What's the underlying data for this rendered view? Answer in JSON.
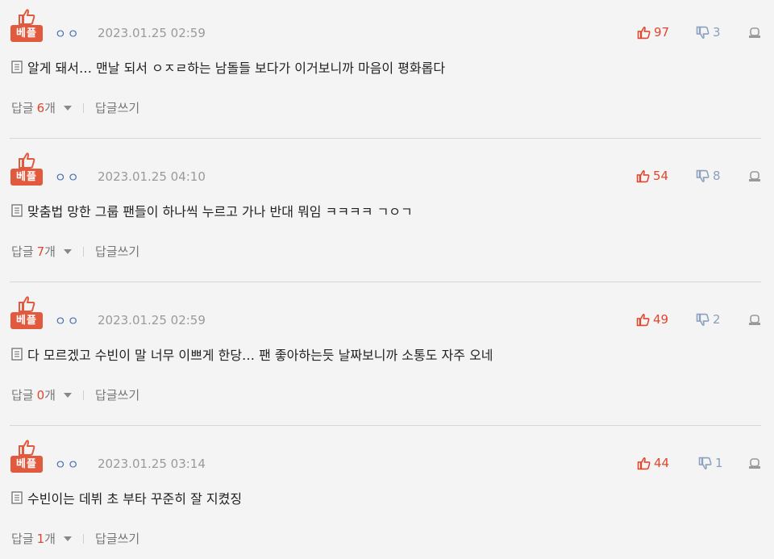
{
  "comments": [
    {
      "badge": "베플",
      "nickname": "ㅇㅇ",
      "date": "2023.01.25 02:59",
      "likes": "97",
      "dislikes": "3",
      "text": "알게 돼서… 맨날 되서 ㅇㅈㄹ하는 남돌들 보다가 이거보니까 마음이 평화롭다",
      "reply_label": "답글",
      "reply_count": "6",
      "reply_unit": "개",
      "write_label": "답글쓰기"
    },
    {
      "badge": "베플",
      "nickname": "ㅇㅇ",
      "date": "2023.01.25 04:10",
      "likes": "54",
      "dislikes": "8",
      "text": "맞춤법 망한 그룹 팬들이 하나씩 누르고 가나 반대 뭐임 ㅋㅋㅋㅋ ㄱㅇㄱ",
      "reply_label": "답글",
      "reply_count": "7",
      "reply_unit": "개",
      "write_label": "답글쓰기"
    },
    {
      "badge": "베플",
      "nickname": "ㅇㅇ",
      "date": "2023.01.25 02:59",
      "likes": "49",
      "dislikes": "2",
      "text": "다 모르겠고 수빈이 말 너무 이쁘게 한당… 팬 좋아하는듯 날짜보니까 소통도 자주 오네",
      "reply_label": "답글",
      "reply_count": "0",
      "reply_unit": "개",
      "write_label": "답글쓰기"
    },
    {
      "badge": "베플",
      "nickname": "ㅇㅇ",
      "date": "2023.01.25 03:14",
      "likes": "44",
      "dislikes": "1",
      "text": "수빈이는 데뷔 초 부타 꾸준히 잘 지켰징",
      "reply_label": "답글",
      "reply_count": "1",
      "reply_unit": "개",
      "write_label": "답글쓰기"
    }
  ],
  "colors": {
    "accent_red": "#e25a3e",
    "like_red": "#e0462e",
    "nick_blue": "#4a6fb5",
    "muted_gray": "#9a9a9a"
  },
  "icons": {
    "best": "thumbs-up-icon",
    "like": "thumbs-up-icon",
    "dislike": "thumbs-down-icon",
    "report": "report-icon",
    "comment": "document-icon",
    "expand": "caret-down-icon"
  }
}
